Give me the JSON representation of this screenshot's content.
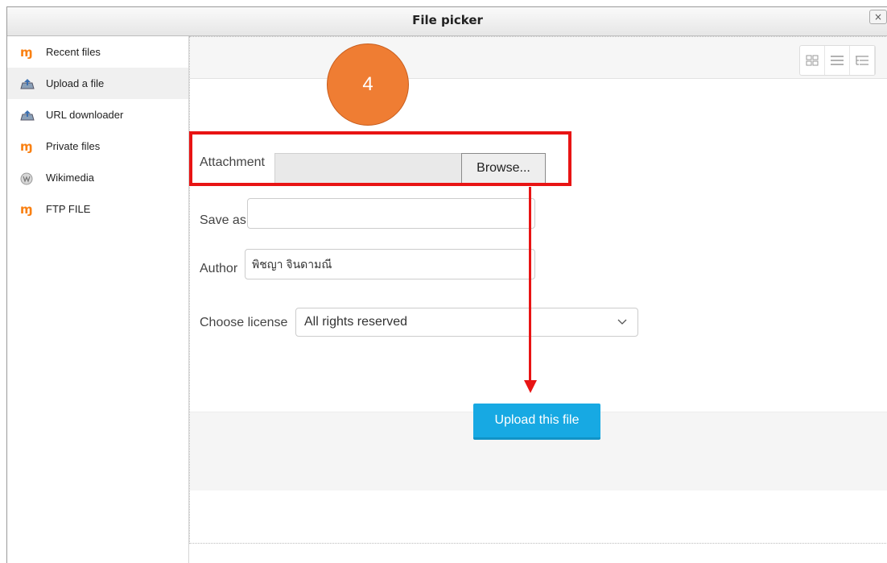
{
  "window": {
    "title": "File picker",
    "close_icon": "×"
  },
  "sidebar": {
    "items": [
      {
        "label": "Recent files",
        "icon": "moodle-icon"
      },
      {
        "label": "Upload a file",
        "icon": "upload-icon"
      },
      {
        "label": "URL downloader",
        "icon": "url-downloader-icon"
      },
      {
        "label": "Private files",
        "icon": "moodle-icon"
      },
      {
        "label": "Wikimedia",
        "icon": "wikimedia-icon"
      },
      {
        "label": "FTP FILE",
        "icon": "moodle-icon"
      }
    ],
    "active_index": 1
  },
  "form": {
    "attachment_label": "Attachment",
    "browse_label": "Browse...",
    "save_as_label": "Save as",
    "save_as_value": "",
    "author_label": "Author",
    "author_value": "พิชญา จินดามณี",
    "license_label": "Choose license",
    "license_value": "All rights reserved",
    "upload_label": "Upload this file"
  },
  "annotation": {
    "step_number": "4"
  },
  "colors": {
    "upload_button": "#17a9e3",
    "step_badge": "#ef7d33",
    "highlight": "#e81414",
    "moodle_icon": "#f98012"
  }
}
